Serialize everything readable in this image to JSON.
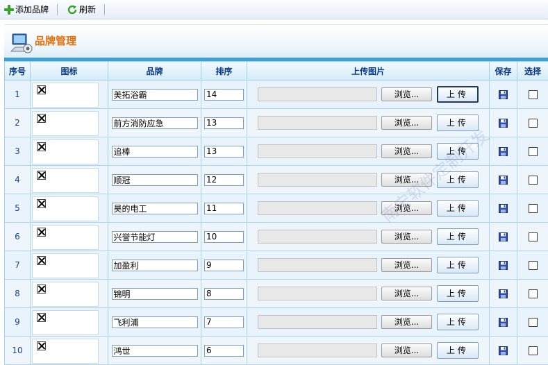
{
  "toolbar": {
    "add_label": "添加品牌",
    "refresh_label": "刷新"
  },
  "header": {
    "title": "品牌管理"
  },
  "columns": [
    "序号",
    "图标",
    "品牌",
    "排序",
    "上传图片",
    "保存",
    "选择"
  ],
  "browse_label": "浏览...",
  "upload_label": "上传",
  "rows": [
    {
      "no": "1",
      "brand": "美拓浴霸",
      "sort": "14"
    },
    {
      "no": "2",
      "brand": "前方消防应急",
      "sort": "13"
    },
    {
      "no": "3",
      "brand": "追棒",
      "sort": "13"
    },
    {
      "no": "4",
      "brand": "顺冠",
      "sort": "12"
    },
    {
      "no": "5",
      "brand": "昊的电工",
      "sort": "11"
    },
    {
      "no": "6",
      "brand": "兴誉节能灯",
      "sort": "10"
    },
    {
      "no": "7",
      "brand": "加盈利",
      "sort": "9"
    },
    {
      "no": "8",
      "brand": "锦明",
      "sort": "8"
    },
    {
      "no": "9",
      "brand": "飞利浦",
      "sort": "7"
    },
    {
      "no": "10",
      "brand": "鸿世",
      "sort": "6"
    }
  ],
  "watermark_text": "南宁软件定制开发",
  "colors": {
    "accent": "#e8700b",
    "header_text": "#0b3a83",
    "bar": "#3f9fd7"
  },
  "icons": [
    "plus-icon",
    "refresh-icon",
    "brand-manage-icon",
    "broken-image-icon",
    "save-icon",
    "checkbox"
  ]
}
